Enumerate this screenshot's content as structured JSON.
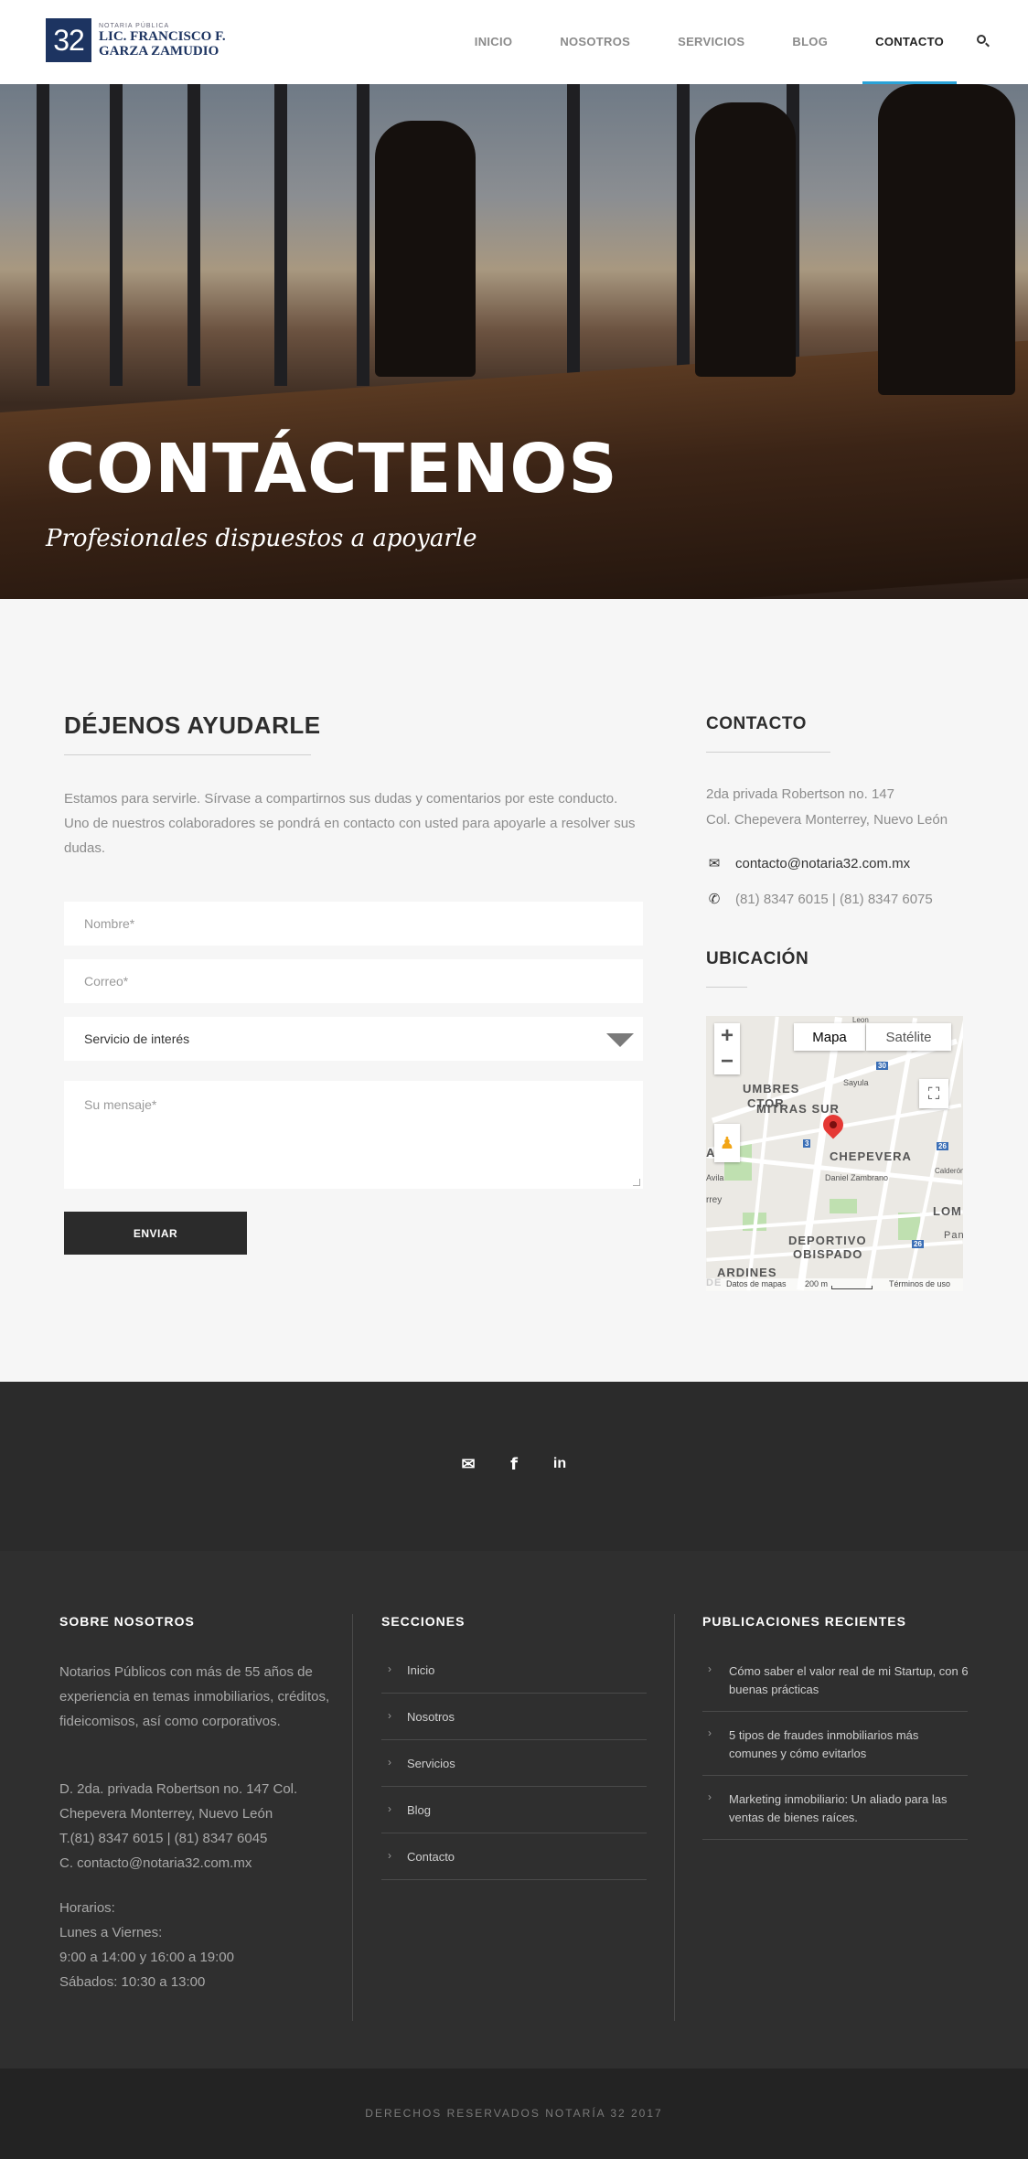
{
  "header": {
    "logo_number": "32",
    "logo_small": "NOTARIA PÚBLICA",
    "logo_line1": "LIC. FRANCISCO F.",
    "logo_line2": "GARZA ZAMUDIO",
    "nav": [
      "INICIO",
      "NOSOTROS",
      "SERVICIOS",
      "BLOG",
      "CONTACTO"
    ],
    "active_nav": "CONTACTO",
    "search_icon": "search-icon"
  },
  "hero": {
    "title": "CONTÁCTENOS",
    "subtitle": "Profesionales dispuestos a apoyarle"
  },
  "form_section": {
    "title": "DÉJENOS AYUDARLE",
    "intro": "Estamos para servirle. Sírvase a compartirnos sus dudas y comentarios por este conducto. Uno de nuestros colaboradores se pondrá en contacto con usted para apoyarle a resolver sus dudas.",
    "name_placeholder": "Nombre*",
    "email_placeholder": "Correo*",
    "service_value": "Servicio de interés",
    "message_placeholder": "Su mensaje*",
    "send_label": "ENVIAR"
  },
  "contact": {
    "title": "CONTACTO",
    "address_line1": "2da privada Robertson no. 147",
    "address_line2": "Col. Chepevera Monterrey, Nuevo León",
    "email": "contacto@notaria32.com.mx",
    "phone": "(81) 8347 6015 | (81) 8347 6075",
    "location_title": "UBICACIÓN"
  },
  "map": {
    "type_map": "Mapa",
    "type_satellite": "Satélite",
    "labels": [
      "UMBRES",
      "CTOR",
      "MITRAS SUR",
      "CHEPEVERA",
      "DEPORTIVO",
      "OBISPADO",
      "LOM",
      "A S",
      "ARDINES",
      "Daniel Zambrano",
      "Sayula",
      "Avila",
      "Pan",
      "Calderón",
      "Leon",
      "rrey",
      "DE"
    ],
    "shields": [
      "30",
      "3",
      "26",
      "26"
    ],
    "footer_data": "Datos de mapas",
    "footer_scale": "200 m",
    "footer_terms": "Términos de uso"
  },
  "social": {
    "icons": [
      "envelope-icon",
      "facebook-icon",
      "linkedin-icon"
    ]
  },
  "footer": {
    "about_title": "SOBRE NOSOTROS",
    "about_text": "Notarios Públicos con más de 55 años de experiencia en temas inmobiliarios, créditos, fideicomisos, así como corporativos.",
    "address_lines": [
      "D. 2da. privada Robertson no. 147 Col.",
      "Chepevera Monterrey, Nuevo León",
      "T.(81) 8347 6015 | (81) 8347 6045",
      "C. contacto@notaria32.com.mx"
    ],
    "hours_lines": [
      "Horarios:",
      "Lunes a Viernes:",
      "9:00 a 14:00 y 16:00 a 19:00",
      "Sábados: 10:30 a 13:00"
    ],
    "sections_title": "SECCIONES",
    "sections": [
      "Inicio",
      "Nosotros",
      "Servicios",
      "Blog",
      "Contacto"
    ],
    "recent_title": "PUBLICACIONES RECIENTES",
    "recent": [
      [
        "Cómo saber el valor real de mi Startup, con 6",
        "buenas prácticas"
      ],
      [
        "5 tipos de fraudes inmobiliarios más",
        "comunes y cómo evitarlos"
      ],
      [
        "Marketing inmobiliario: Un aliado para las",
        "ventas de bienes raíces."
      ]
    ],
    "copyright": "DERECHOS RESERVADOS NOTARÍA 32 2017"
  }
}
